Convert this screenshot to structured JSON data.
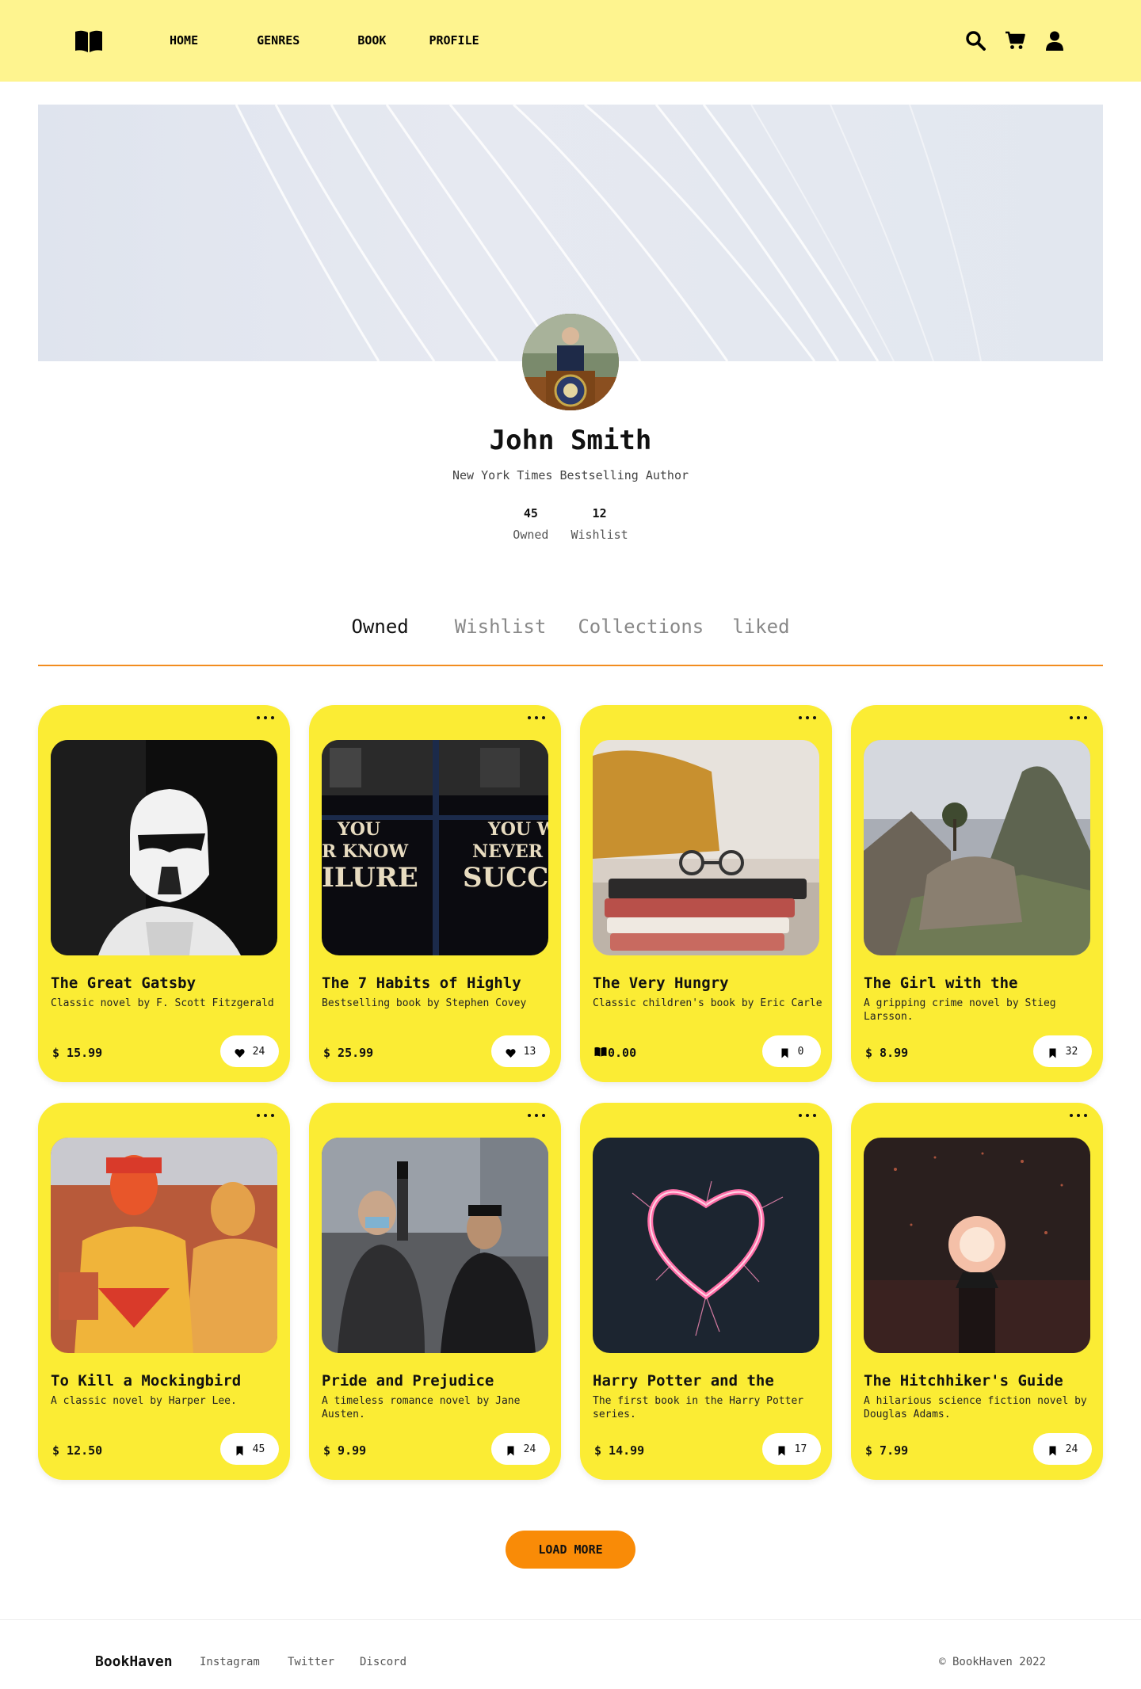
{
  "nav": {
    "logo_icon": "book-open-icon",
    "links": [
      "HOME",
      "GENRES",
      "BOOK",
      "PROFILE"
    ],
    "icons": [
      "search-icon",
      "cart-icon",
      "user-icon"
    ]
  },
  "profile": {
    "name": "John Smith",
    "subtitle": "New York Times Bestselling Author",
    "stats": [
      {
        "value": "45",
        "label": "Owned"
      },
      {
        "value": "12",
        "label": "Wishlist"
      }
    ]
  },
  "tabs": {
    "items": [
      "Owned",
      "Wishlist",
      "Collections",
      "liked"
    ],
    "active": "Owned"
  },
  "colors": {
    "nav_bg": "#fef48f",
    "card_bg": "#fbec34",
    "accent": "#f28c1f",
    "button": "#f98b07"
  },
  "books": [
    {
      "title": "The Great Gatsby",
      "desc": "Classic novel by F. Scott Fitzgerald",
      "price": "$ 15.99",
      "icon": "heart-icon",
      "count": "24"
    },
    {
      "title": "The 7 Habits of Highly",
      "desc": "Bestselling book by Stephen Covey",
      "price": "$ 25.99",
      "icon": "heart-icon",
      "count": "13"
    },
    {
      "title": "The Very Hungry",
      "desc": "Classic children's book by Eric Carle",
      "price": "0.00",
      "price_icon": "book-open-icon",
      "icon": "bookmark-icon",
      "count": "0"
    },
    {
      "title": "The Girl with the",
      "desc": "A gripping crime novel by Stieg Larsson.",
      "price": "$ 8.99",
      "icon": "bookmark-icon",
      "count": "32"
    },
    {
      "title": "To Kill a Mockingbird",
      "desc": "A classic novel by Harper Lee.",
      "price": "$ 12.50",
      "icon": "bookmark-icon",
      "count": "45"
    },
    {
      "title": "Pride and Prejudice",
      "desc": "A timeless romance novel by Jane Austen.",
      "price": "$ 9.99",
      "icon": "bookmark-icon",
      "count": "24"
    },
    {
      "title": "Harry Potter and the",
      "desc": "The first book in the Harry Potter series.",
      "price": "$ 14.99",
      "icon": "bookmark-icon",
      "count": "17"
    },
    {
      "title": "The Hitchhiker's Guide",
      "desc": "A hilarious science fiction novel by Douglas Adams.",
      "price": "$ 7.99",
      "icon": "bookmark-icon",
      "count": "24"
    }
  ],
  "load_more": "LOAD MORE",
  "footer": {
    "brand": "BookHaven",
    "links": [
      "Instagram",
      "Twitter",
      "Discord"
    ],
    "copyright": "© BookHaven 2022"
  }
}
